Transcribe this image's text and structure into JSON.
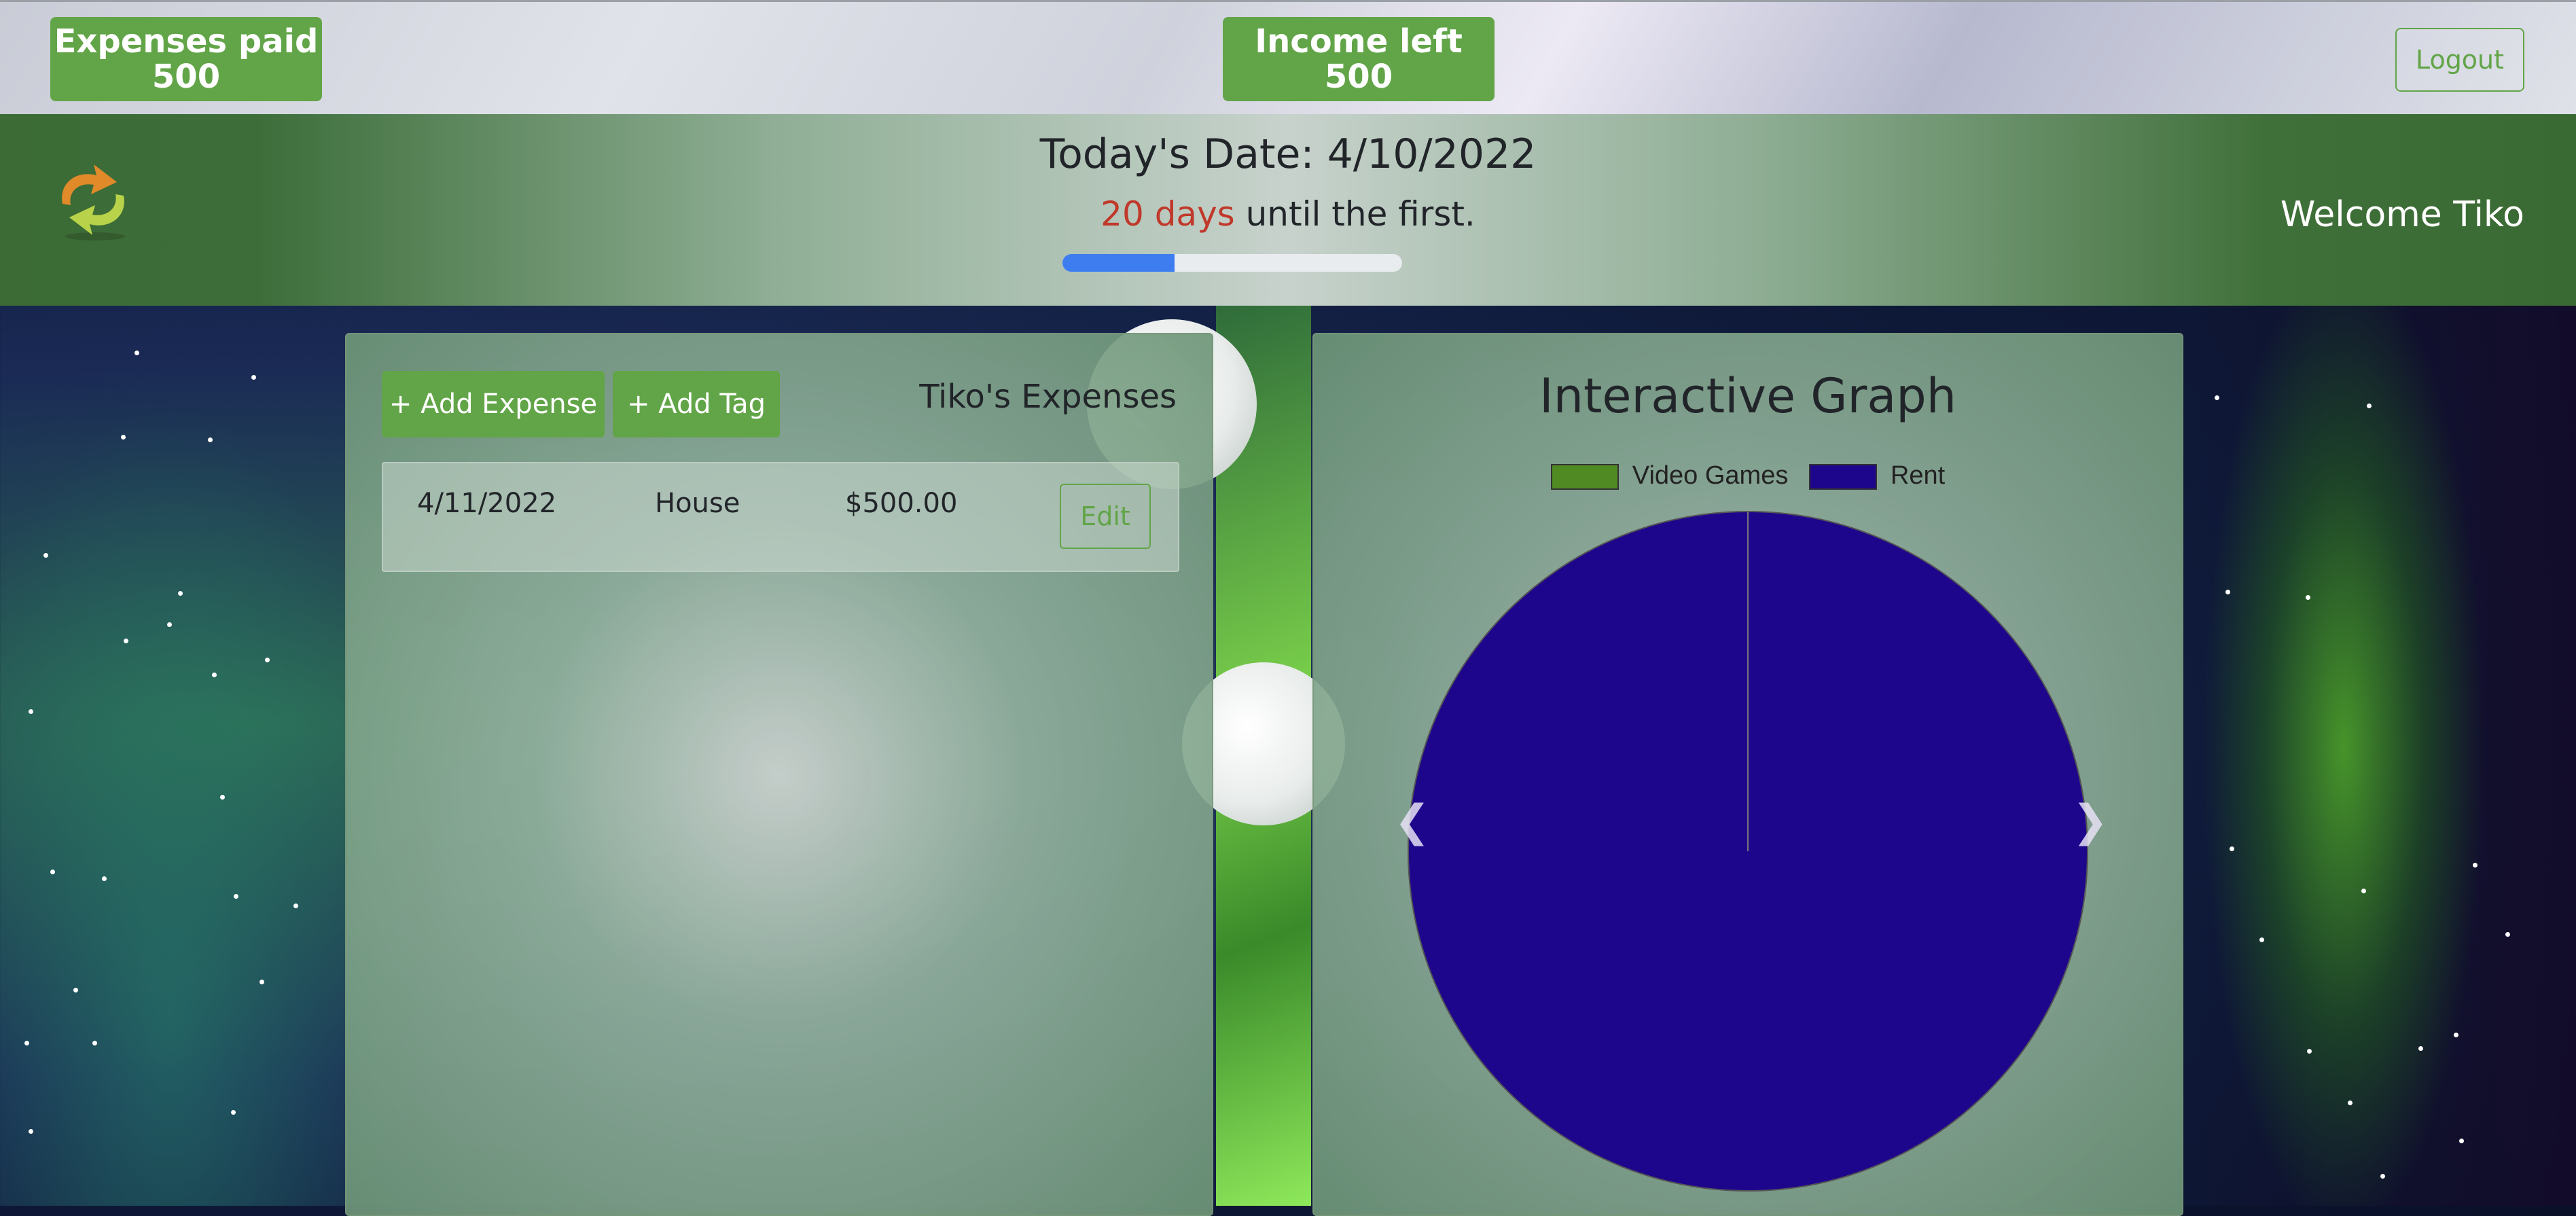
{
  "top_bar": {
    "expenses_paid": {
      "label": "Expenses paid",
      "value": "500"
    },
    "income_left": {
      "label": "Income left",
      "value": "500"
    },
    "logout_label": "Logout"
  },
  "header": {
    "logo_icon": "recycle-arrows-logo",
    "date_title": "Today's Date: 4/10/2022",
    "countdown_days": "20 days",
    "countdown_rest": " until the first.",
    "progress_fraction": 0.33,
    "welcome": "Welcome Tiko"
  },
  "expenses_panel": {
    "add_expense_label": "+ Add Expense",
    "add_tag_label": "+ Add Tag",
    "title": "Tiko's Expenses",
    "rows": [
      {
        "date": "4/11/2022",
        "tag": "House",
        "amount": "$500.00",
        "edit_label": "Edit"
      }
    ]
  },
  "graph_panel": {
    "title": "Interactive Graph",
    "prev_icon": "chevron-left-icon",
    "next_icon": "chevron-right-icon"
  },
  "chart_data": {
    "type": "pie",
    "title": "Interactive Graph",
    "legend_position": "top",
    "categories": [
      "Video Games",
      "Rent"
    ],
    "values": [
      0,
      500
    ],
    "colors": [
      "#4f8a22",
      "#1e068c"
    ]
  },
  "colors": {
    "accent_green": "#62a548",
    "progress_blue": "#3d7df0",
    "countdown_red": "#c0392b"
  }
}
